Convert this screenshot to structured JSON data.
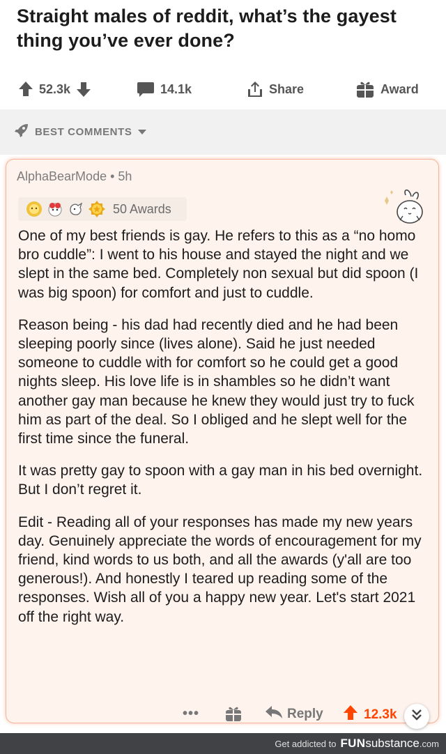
{
  "post": {
    "title": "Straight males of reddit, what’s the gayest thing you’ve ever done?"
  },
  "actions": {
    "votes": "52.3k",
    "comments": "14.1k",
    "share": "Share",
    "award": "Award"
  },
  "sort": {
    "label": "BEST COMMENTS"
  },
  "comment": {
    "author": "AlphaBearMode",
    "age": "5h",
    "awards_count": "50 Awards",
    "paragraphs": [
      "One of my best friends is gay. He refers to this as a “no homo bro cuddle”: I went to his house and stayed the night and we slept in the same bed. Completely non sexual but did spoon (I was big spoon) for comfort and just to cuddle.",
      "Reason being - his dad had recently died and he had been sleeping poorly since (lives alone). Said he just needed someone to cuddle with for comfort so he could get a good nights sleep. His love life is in shambles so he didn’t want another gay man because he knew they would just try to fuck him as part of the deal. So I obliged and he slept well for the first time since the funeral.",
      "It was pretty gay to spoon with a gay man in his bed overnight. But I don’t regret it.",
      "Edit - Reading all of your responses has made my new years day. Genuinely appreciate the words of encouragement for my friend, kind words to us both, and all the awards (y'all are too generous!). And honestly I teared up reading some of the responses. Wish all of you a happy new year. Let's start 2021 off the right way."
    ],
    "more": "•••",
    "reply": "Reply",
    "score": "12.3k"
  },
  "footer": {
    "text": "Get addicted to",
    "brand_fun": "FUN",
    "brand_sub": "substance",
    "brand_tld": ".com"
  },
  "colors": {
    "upvote": "#ff4500",
    "card_bg": "#fff3ee",
    "card_border": "#f4b59b",
    "footer_bg": "#404246"
  },
  "icons": [
    "upvote-icon",
    "downvote-icon",
    "comment-icon",
    "share-icon",
    "gift-icon",
    "rocket-icon",
    "chevron-down-icon",
    "reply-arrow-icon",
    "double-chevron-down-icon"
  ]
}
